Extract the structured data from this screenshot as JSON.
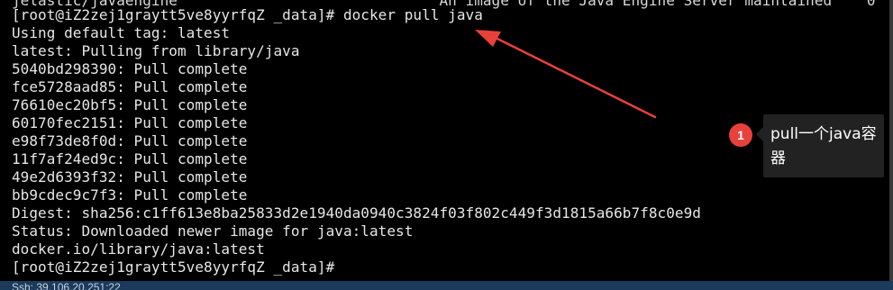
{
  "terminal": {
    "partial_top_line": "jelastic/javaengine                              An image of the Java Engine Server maintained    0",
    "lines": [
      "[root@iZ2zej1graytt5ve8yyrfqZ _data]# docker pull java",
      "Using default tag: latest",
      "latest: Pulling from library/java",
      "5040bd298390: Pull complete",
      "fce5728aad85: Pull complete",
      "76610ec20bf5: Pull complete",
      "60170fec2151: Pull complete",
      "e98f73de8f0d: Pull complete",
      "11f7af24ed9c: Pull complete",
      "49e2d6393f32: Pull complete",
      "bb9cdec9c7f3: Pull complete",
      "Digest: sha256:c1ff613e8ba25833d2e1940da0940c3824f03f802c449f3d1815a66b7f8c0e9d",
      "Status: Downloaded newer image for java:latest",
      "docker.io/library/java:latest",
      "[root@iZ2zej1graytt5ve8yyrfqZ _data]#"
    ],
    "status_bar_text": "Ssh: 39.106.20.251:22"
  },
  "annotation": {
    "badge_number": "1",
    "tooltip_text": "pull一个java容器",
    "color_badge": "#e8413c",
    "color_arrow": "#e8413c",
    "color_tooltip_bg": "#222222"
  }
}
